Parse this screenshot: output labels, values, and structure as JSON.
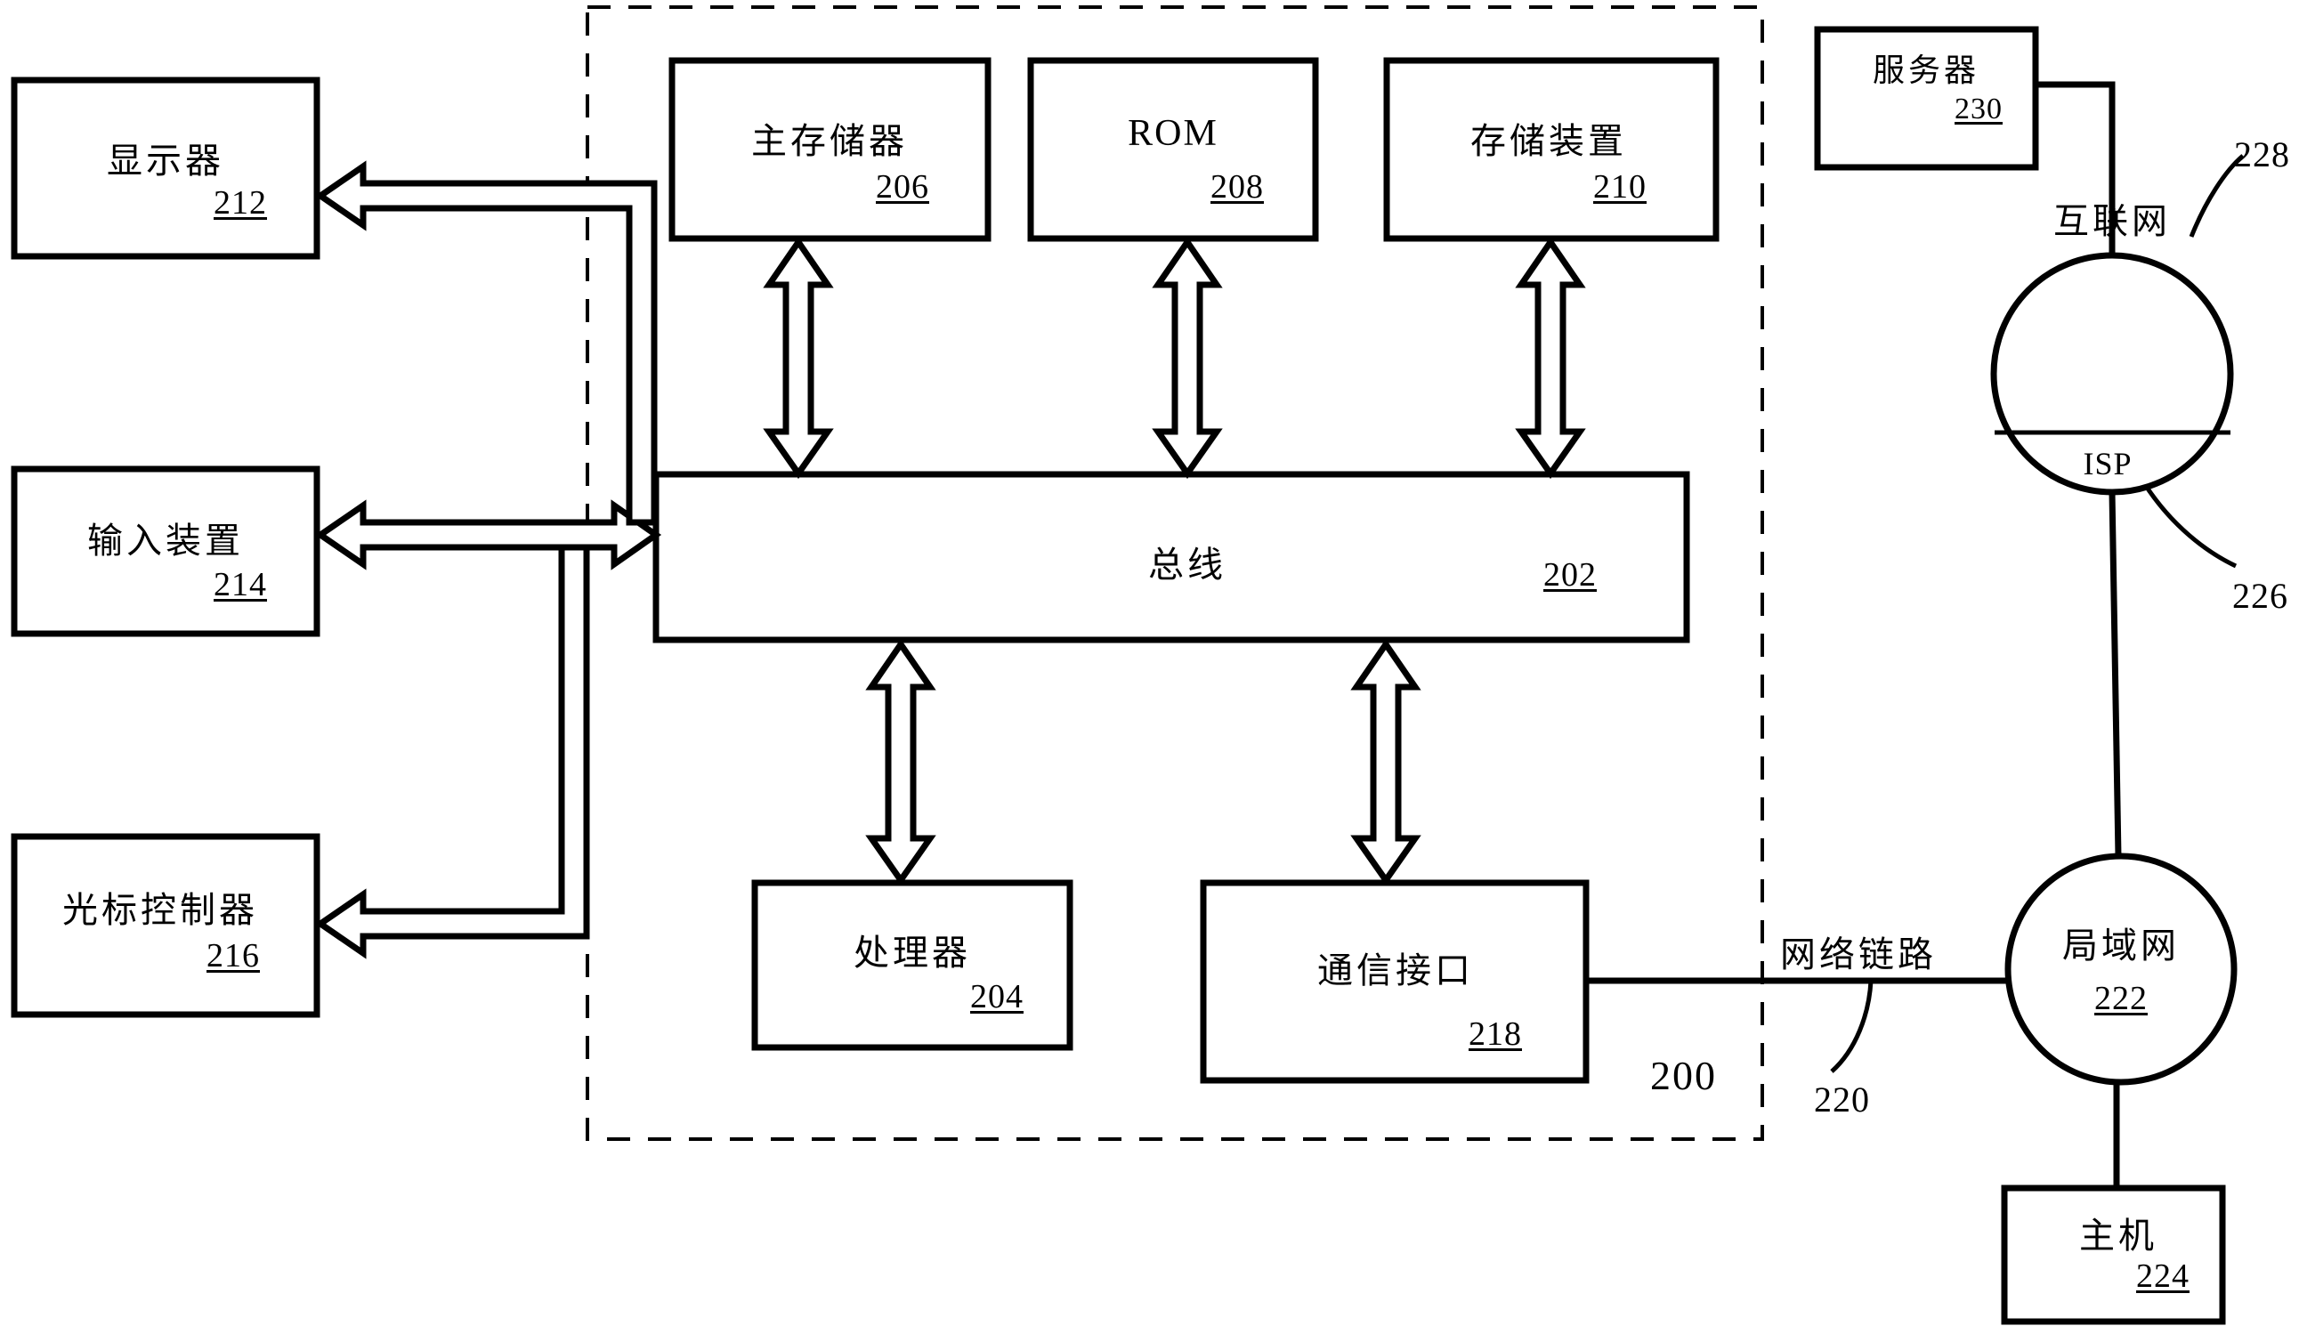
{
  "diagram": {
    "figure_ref": "200",
    "blocks": {
      "display": {
        "label": "显示器",
        "ref": "212"
      },
      "input_device": {
        "label": "输入装置",
        "ref": "214"
      },
      "cursor_control": {
        "label": "光标控制器",
        "ref": "216"
      },
      "main_memory": {
        "label": "主存储器",
        "ref": "206"
      },
      "rom": {
        "label": "ROM",
        "ref": "208"
      },
      "storage_device": {
        "label": "存储装置",
        "ref": "210"
      },
      "bus": {
        "label": "总线",
        "ref": "202"
      },
      "processor": {
        "label": "处理器",
        "ref": "204"
      },
      "comm_interface": {
        "label": "通信接口",
        "ref": "218"
      },
      "server": {
        "label": "服务器",
        "ref": "230"
      },
      "host": {
        "label": "主机",
        "ref": "224"
      }
    },
    "clouds": {
      "internet": {
        "top_label": "互联网",
        "bottom_label": "ISP",
        "ref_top": "228",
        "ref_bottom": "226"
      },
      "lan": {
        "label": "局域网",
        "ref": "222"
      }
    },
    "links": {
      "network_link": {
        "label": "网络链路",
        "ref": "220"
      }
    }
  }
}
